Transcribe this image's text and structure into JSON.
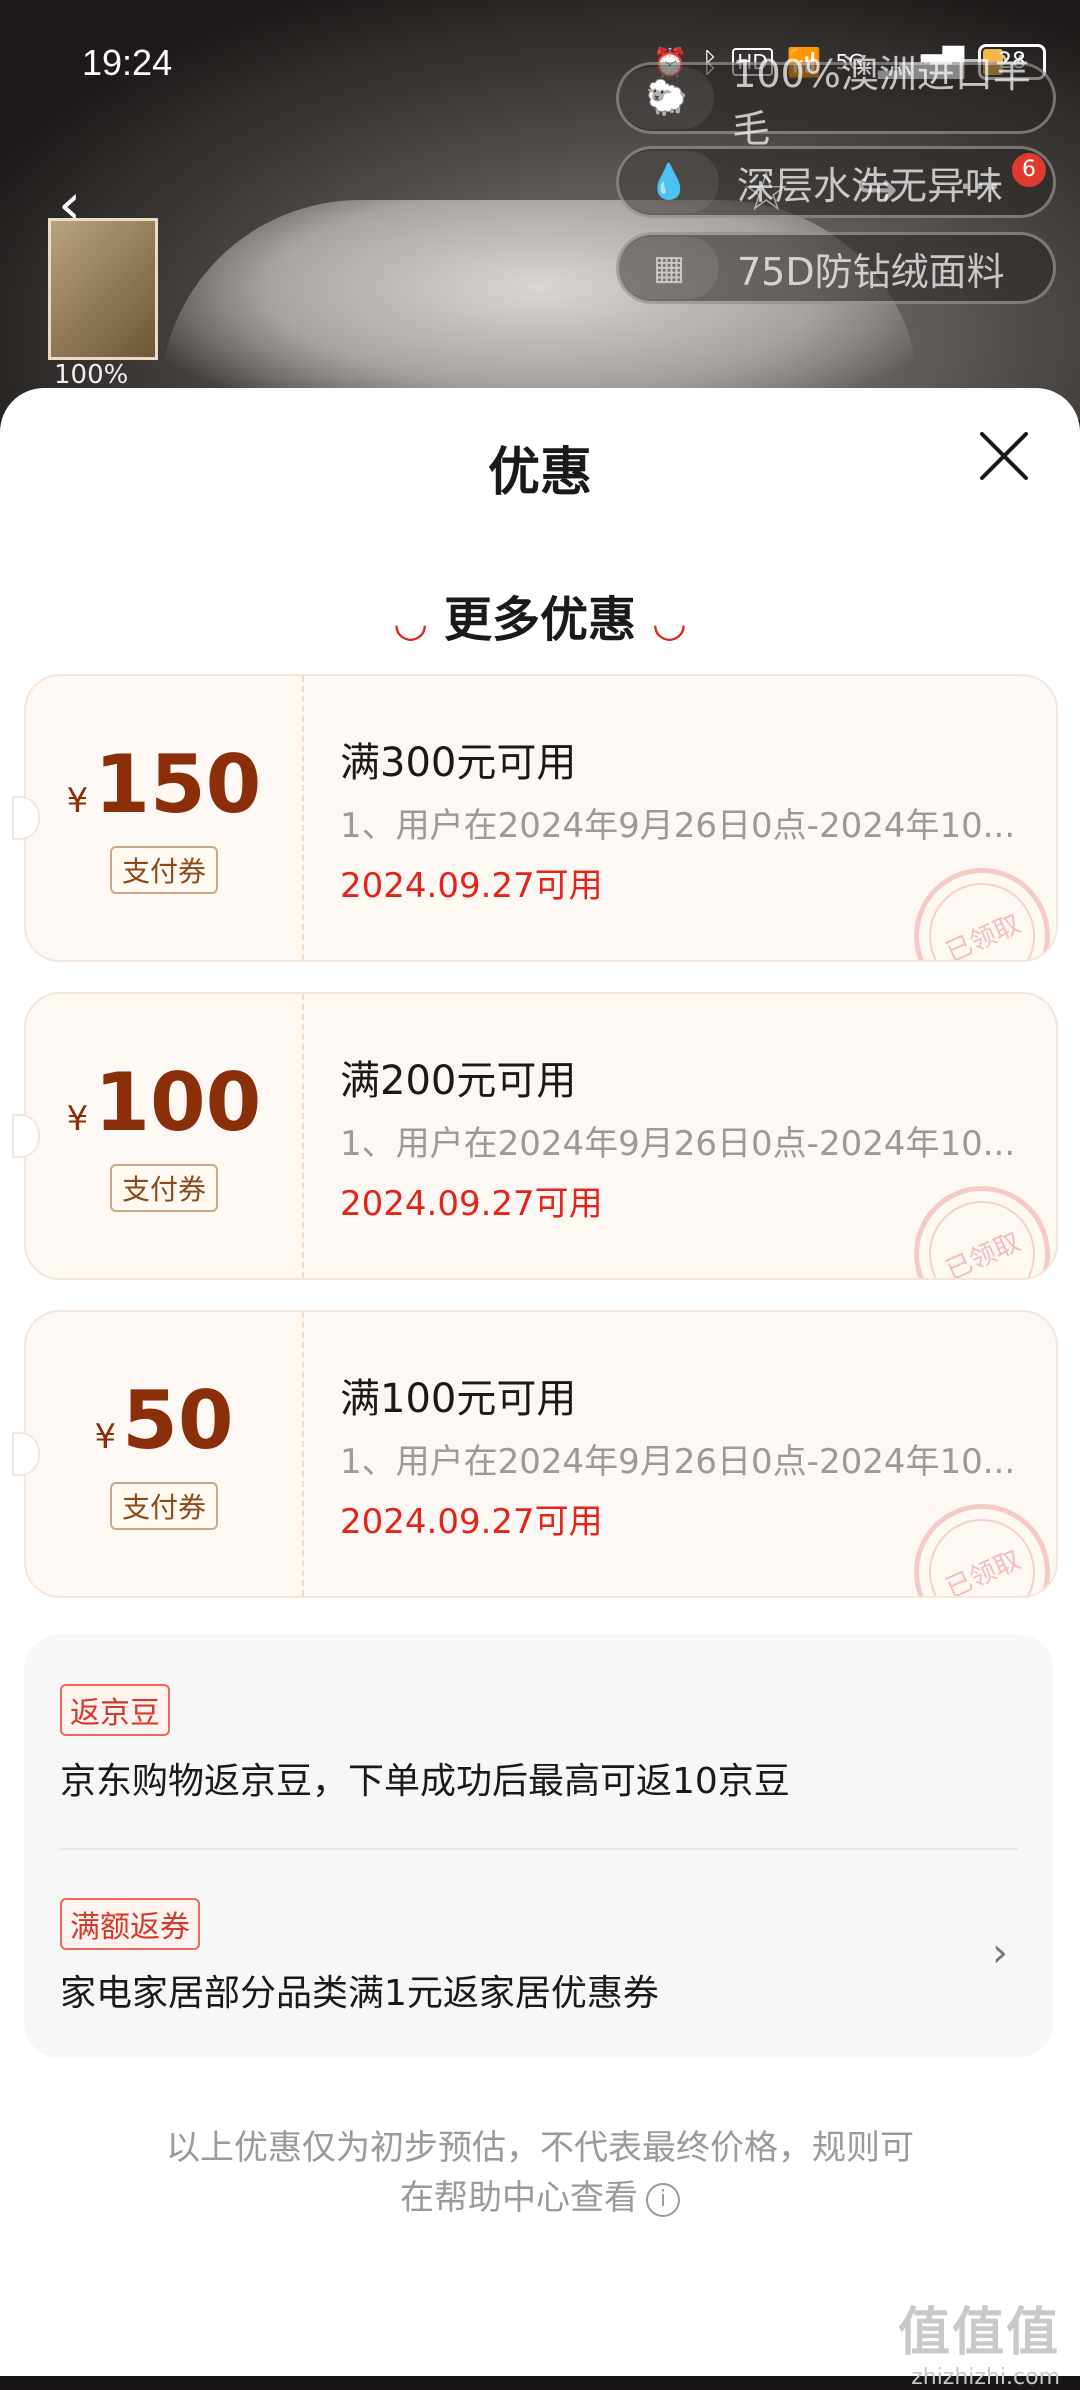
{
  "status_bar": {
    "time": "19:24",
    "hd": "HD",
    "network": "5G",
    "battery": "28"
  },
  "product_bg": {
    "features": [
      "100%澳洲进口羊毛",
      "深层水洗无异味",
      "75D防钻绒面料"
    ],
    "thumb_label": "100%",
    "cart_badge": "6"
  },
  "sheet": {
    "title": "优惠",
    "section_title": "更多优惠",
    "coupons": [
      {
        "currency": "¥",
        "amount": "150",
        "type": "支付券",
        "condition": "满300元可用",
        "rule": "1、用户在2024年9月26日0点-2024年10...",
        "date": "2024.09.27可用",
        "stamp": "已领取"
      },
      {
        "currency": "¥",
        "amount": "100",
        "type": "支付券",
        "condition": "满200元可用",
        "rule": "1、用户在2024年9月26日0点-2024年10...",
        "date": "2024.09.27可用",
        "stamp": "已领取"
      },
      {
        "currency": "¥",
        "amount": "50",
        "type": "支付券",
        "condition": "满100元可用",
        "rule": "1、用户在2024年9月26日0点-2024年10...",
        "date": "2024.09.27可用",
        "stamp": "已领取"
      }
    ],
    "benefits": [
      {
        "tag": "返京豆",
        "text": "京东购物返京豆，下单成功后最高可返10京豆"
      },
      {
        "tag": "满额返券",
        "text": "家电家居部分品类满1元返家居优惠券"
      }
    ],
    "disclaimer_line1": "以上优惠仅为初步预估，不代表最终价格，规则可",
    "disclaimer_line2": "在帮助中心查看"
  },
  "watermark": {
    "logo": "值值值",
    "url": "zhizhizhi.com"
  },
  "colors": {
    "accent_red": "#e1251b",
    "coupon_brown": "#8b2e0a",
    "coupon_bg": "#fdf8f4"
  }
}
